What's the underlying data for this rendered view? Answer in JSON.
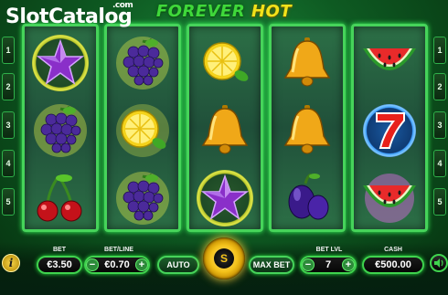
{
  "watermark": {
    "slot": "Slot",
    "catalog": "Catalog",
    "com": ".com"
  },
  "title": {
    "word1": "FOREVER",
    "word2": "HOT"
  },
  "paylines": {
    "left": [
      "1",
      "2",
      "3",
      "4",
      "5"
    ],
    "right": [
      "1",
      "2",
      "3",
      "4",
      "5"
    ]
  },
  "reels": [
    [
      "purple-star-symbol",
      "grapes-symbol",
      "cherries-symbol"
    ],
    [
      "grapes-symbol",
      "lemon-symbol",
      "grapes-symbol"
    ],
    [
      "lemon-symbol",
      "golden-bell-symbol",
      "purple-star-symbol"
    ],
    [
      "golden-bell-symbol",
      "golden-bell-symbol",
      "plum-symbol"
    ],
    [
      "watermelon-symbol",
      "lucky-seven-symbol",
      "watermelon-symbol"
    ]
  ],
  "controls": {
    "bet_label": "BET",
    "bet_value": "€3.50",
    "betline_label": "BET/LINE",
    "betline_value": "€0.70",
    "minus": "−",
    "plus": "+",
    "auto_label": "AUTO",
    "spin_label": "S",
    "maxbet_label": "MAX BET",
    "betlvl_label": "BET LVL",
    "betlvl_value": "7",
    "cash_label": "CASH",
    "cash_value": "€500.00",
    "info_label": "i"
  },
  "colors": {
    "frame": "#46d35a",
    "accent": "#f4c21a",
    "background": "#0e5a22"
  }
}
